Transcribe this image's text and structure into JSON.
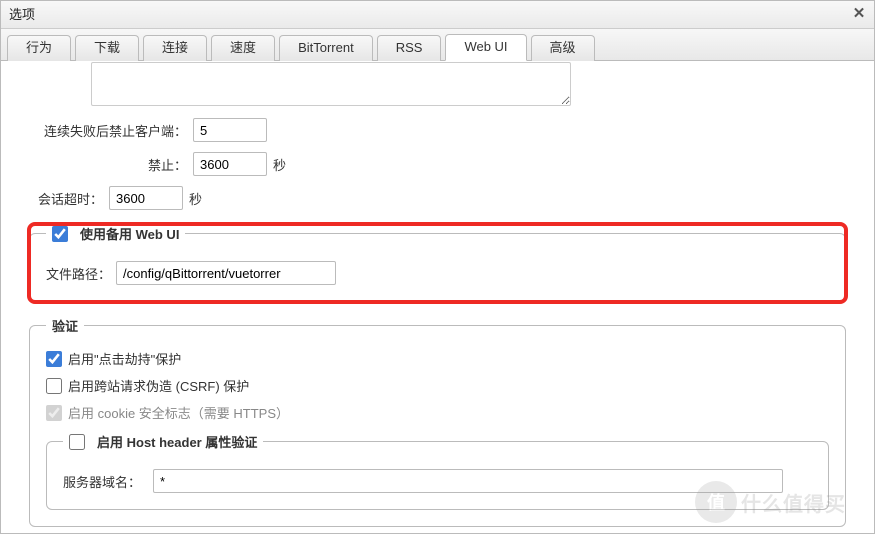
{
  "dialog": {
    "title": "选项"
  },
  "tabs": [
    {
      "label": "行为"
    },
    {
      "label": "下载"
    },
    {
      "label": "连接"
    },
    {
      "label": "速度"
    },
    {
      "label": "BitTorrent"
    },
    {
      "label": "RSS"
    },
    {
      "label": "Web UI"
    },
    {
      "label": "高级"
    }
  ],
  "textarea_value": "",
  "ban_after_fail": {
    "label": "连续失败后禁止客户端：",
    "value": "5"
  },
  "ban_for": {
    "label": "禁止：",
    "value": "3600",
    "unit": "秒"
  },
  "session_timeout": {
    "label": "会话超时：",
    "value": "3600",
    "unit": "秒"
  },
  "alt_webui": {
    "legend": "使用备用 Web UI",
    "checked": true,
    "path_label": "文件路径：",
    "path_value": "/config/qBittorrent/vuetorrer"
  },
  "auth": {
    "legend": "验证",
    "clickjacking": {
      "label": "启用\"点击劫持\"保护",
      "checked": true
    },
    "csrf": {
      "label": "启用跨站请求伪造 (CSRF) 保护",
      "checked": false
    },
    "cookie_secure": {
      "label": "启用 cookie 安全标志（需要 HTTPS）",
      "checked": true,
      "disabled": true
    },
    "host_header": {
      "legend": "启用 Host header 属性验证",
      "checked": false,
      "domain_label": "服务器域名：",
      "domain_value": "*"
    }
  },
  "watermark": "什么值得买"
}
